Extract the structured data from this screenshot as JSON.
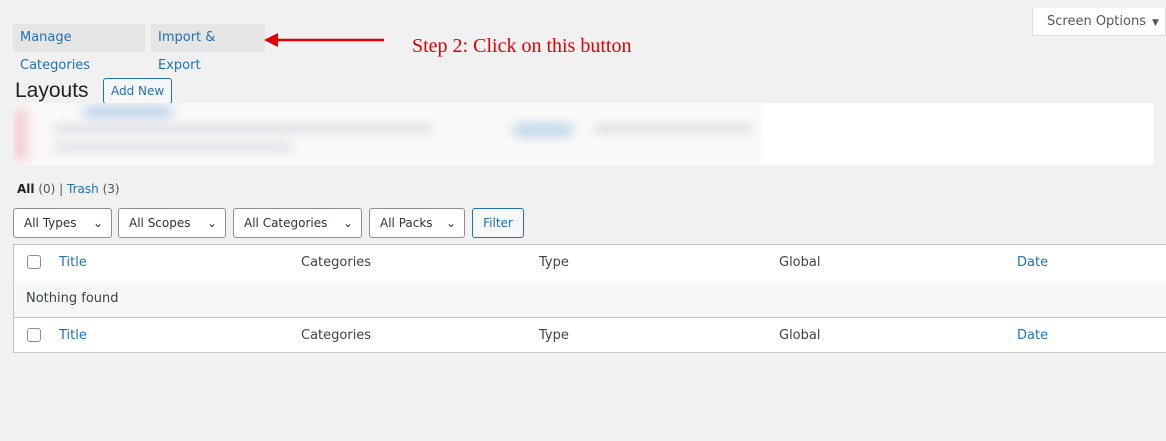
{
  "top_tabs": {
    "manage_categories": "Manage Categories",
    "import_export": "Import & Export"
  },
  "screen_options": {
    "label": "Screen Options",
    "caret": "▼"
  },
  "annotation": {
    "text": "Step 2: Click on this button",
    "color": "#e00000"
  },
  "page": {
    "title": "Layouts",
    "add_new": "Add New"
  },
  "views": {
    "all_label": "All",
    "all_count": "(0)",
    "separator": "|",
    "trash_label": "Trash",
    "trash_count": "(3)"
  },
  "filters": {
    "types": "All Types",
    "scopes": "All Scopes",
    "categories": "All Categories",
    "packs": "All Packs",
    "filter_button": "Filter",
    "chevron": "⌄"
  },
  "table": {
    "columns": [
      "Title",
      "Categories",
      "Type",
      "Global",
      "Date"
    ],
    "empty_message": "Nothing found"
  },
  "colors": {
    "accent": "#2271b1",
    "background": "#f1f1f1"
  }
}
